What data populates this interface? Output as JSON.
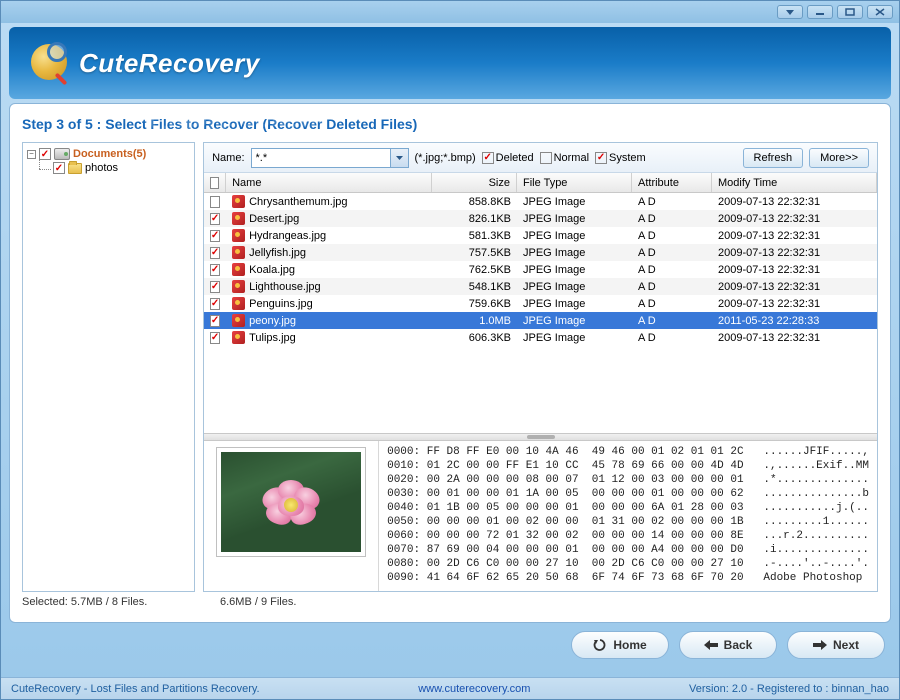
{
  "app": {
    "title": "CuteRecovery"
  },
  "step": {
    "header": "Step 3 of 5 : Select Files to Recover (Recover Deleted Files)"
  },
  "tree": {
    "root": {
      "label": "Documents(5)",
      "checked": true,
      "expanded": true
    },
    "child": {
      "label": "photos",
      "checked": true
    }
  },
  "filter": {
    "name_label": "Name:",
    "pattern": "*.*",
    "types_hint": "(*.jpg;*.bmp)",
    "deleted": {
      "label": "Deleted",
      "checked": true
    },
    "normal": {
      "label": "Normal",
      "checked": false
    },
    "system": {
      "label": "System",
      "checked": true
    },
    "refresh": "Refresh",
    "more": "More>>"
  },
  "columns": {
    "name": "Name",
    "size": "Size",
    "type": "File Type",
    "attr": "Attribute",
    "time": "Modify Time"
  },
  "files": [
    {
      "checked": false,
      "name": "Chrysanthemum.jpg",
      "size": "858.8KB",
      "type": "JPEG Image",
      "attr": "A D",
      "time": "2009-07-13 22:32:31",
      "selected": false
    },
    {
      "checked": true,
      "name": "Desert.jpg",
      "size": "826.1KB",
      "type": "JPEG Image",
      "attr": "A D",
      "time": "2009-07-13 22:32:31",
      "selected": false
    },
    {
      "checked": true,
      "name": "Hydrangeas.jpg",
      "size": "581.3KB",
      "type": "JPEG Image",
      "attr": "A D",
      "time": "2009-07-13 22:32:31",
      "selected": false
    },
    {
      "checked": true,
      "name": "Jellyfish.jpg",
      "size": "757.5KB",
      "type": "JPEG Image",
      "attr": "A D",
      "time": "2009-07-13 22:32:31",
      "selected": false
    },
    {
      "checked": true,
      "name": "Koala.jpg",
      "size": "762.5KB",
      "type": "JPEG Image",
      "attr": "A D",
      "time": "2009-07-13 22:32:31",
      "selected": false
    },
    {
      "checked": true,
      "name": "Lighthouse.jpg",
      "size": "548.1KB",
      "type": "JPEG Image",
      "attr": "A D",
      "time": "2009-07-13 22:32:31",
      "selected": false
    },
    {
      "checked": true,
      "name": "Penguins.jpg",
      "size": "759.6KB",
      "type": "JPEG Image",
      "attr": "A D",
      "time": "2009-07-13 22:32:31",
      "selected": false
    },
    {
      "checked": true,
      "name": "peony.jpg",
      "size": "1.0MB",
      "type": "JPEG Image",
      "attr": "A D",
      "time": "2011-05-23 22:28:33",
      "selected": true
    },
    {
      "checked": true,
      "name": "Tulips.jpg",
      "size": "606.3KB",
      "type": "JPEG Image",
      "attr": "A D",
      "time": "2009-07-13 22:32:31",
      "selected": false
    }
  ],
  "hex": "0000: FF D8 FF E0 00 10 4A 46  49 46 00 01 02 01 01 2C   ......JFIF.....,\n0010: 01 2C 00 00 FF E1 10 CC  45 78 69 66 00 00 4D 4D   .,......Exif..MM\n0020: 00 2A 00 00 00 08 00 07  01 12 00 03 00 00 00 01   .*..............\n0030: 00 01 00 00 01 1A 00 05  00 00 00 01 00 00 00 62   ...............b\n0040: 01 1B 00 05 00 00 00 01  00 00 00 6A 01 28 00 03   ...........j.(..\n0050: 00 00 00 01 00 02 00 00  01 31 00 02 00 00 00 1B   .........1......\n0060: 00 00 00 72 01 32 00 02  00 00 00 14 00 00 00 8E   ...r.2..........\n0070: 87 69 00 04 00 00 00 01  00 00 00 A4 00 00 00 D0   .i..............\n0080: 00 2D C6 C0 00 00 27 10  00 2D C6 C0 00 00 27 10   .-....'..-....'.\n0090: 41 64 6F 62 65 20 50 68  6F 74 6F 73 68 6F 70 20   Adobe Photoshop ",
  "status": {
    "selected": "Selected: 5.7MB / 8 Files.",
    "total": "6.6MB / 9 Files."
  },
  "nav": {
    "home": "Home",
    "back": "Back",
    "next": "Next"
  },
  "footer": {
    "tagline": "CuteRecovery - Lost Files and Partitions Recovery.",
    "url": "www.cuterecovery.com",
    "version": "Version: 2.0 - Registered to : binnan_hao"
  }
}
